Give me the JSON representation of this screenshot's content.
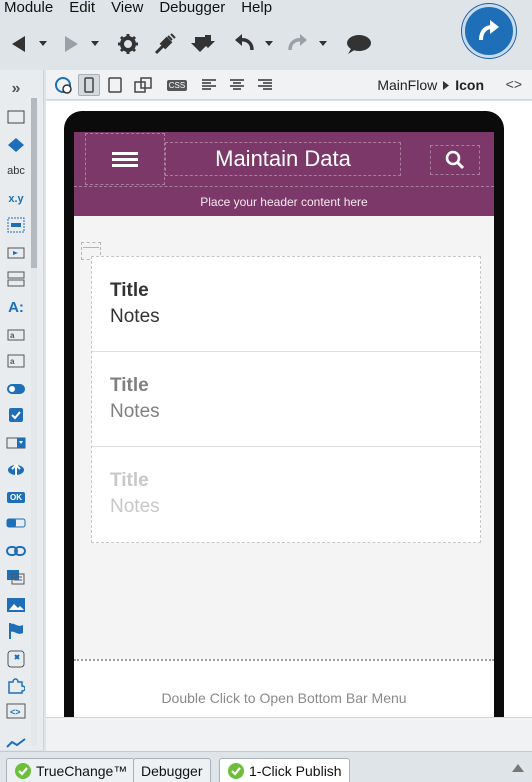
{
  "menu": [
    "Module",
    "Edit",
    "View",
    "Debugger",
    "Help"
  ],
  "editor": {
    "breadcrumb_parent": "MainFlow",
    "breadcrumb_current": "Icon",
    "code_toggle": "<>",
    "css_label": "CSS"
  },
  "widget_labels": {
    "text": "abc",
    "expression": "x.y",
    "label": "A:",
    "ok": "OK"
  },
  "app": {
    "title": "Maintain Data",
    "header_placeholder": "Place your header content here",
    "bottom_bar_hint": "Double Click to Open Bottom Bar Menu",
    "accent": "#7b3868"
  },
  "list": [
    {
      "title": "Title",
      "notes": "Notes",
      "title_color": "#333333",
      "notes_color": "#333333"
    },
    {
      "title": "Title",
      "notes": "Notes",
      "title_color": "#808080",
      "notes_color": "#808080"
    },
    {
      "title": "Title",
      "notes": "Notes",
      "title_color": "#c8c8c8",
      "notes_color": "#c8c8c8"
    }
  ],
  "tabs": [
    {
      "label": "TrueChange™",
      "icon": "check-circle-icon"
    },
    {
      "label": "Debugger",
      "icon": ""
    },
    {
      "label": "1-Click Publish",
      "icon": "check-circle-icon"
    }
  ]
}
